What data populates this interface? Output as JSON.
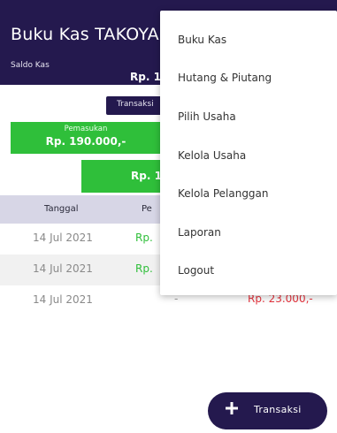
{
  "header": {
    "title": "Buku Kas TAKOYAKI",
    "saldo_label": "Saldo Kas",
    "saldo_value": "Rp. 1"
  },
  "transaksi_strip_label": "Transaksi",
  "pemasukan": {
    "label": "Pemasukan",
    "value": "Rp. 190.000,-"
  },
  "total_value": "Rp. 1",
  "table": {
    "headers": [
      "Tanggal",
      "Pe"
    ],
    "rows": [
      {
        "date": "14 Jul 2021",
        "pemasukan": "Rp.",
        "dash": "",
        "pengeluaran": ""
      },
      {
        "date": "14 Jul 2021",
        "pemasukan": "Rp.",
        "dash": "",
        "pengeluaran": ""
      },
      {
        "date": "14 Jul 2021",
        "pemasukan": "",
        "dash": "-",
        "pengeluaran": "Rp. 23.000,-"
      }
    ]
  },
  "menu": {
    "items": [
      "Buku Kas",
      "Hutang & Piutang",
      "Pilih Usaha",
      "Kelola Usaha",
      "Kelola Pelanggan",
      "Laporan",
      "Logout"
    ]
  },
  "fab": {
    "label": "Transaksi",
    "icon": "plus-icon"
  },
  "colors": {
    "primary": "#24194e",
    "income": "#2fbf3a",
    "expense": "#e6333d",
    "table_header": "#d7d6e6"
  }
}
